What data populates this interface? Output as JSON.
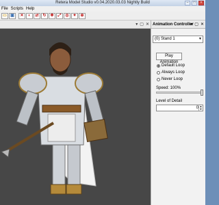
{
  "window": {
    "title": "Retera Model Studio v0.04.2020.03.03 Nightly Build"
  },
  "menu": {
    "items": [
      "File",
      "Scripts",
      "Help"
    ]
  },
  "toolbar": {
    "icons": [
      "folder-icon",
      "save-icon",
      "tool-icon-1",
      "tool-icon-2",
      "tool-icon-3",
      "tool-icon-4",
      "tool-icon-5",
      "tool-icon-6",
      "tool-icon-7",
      "tool-icon-8",
      "tool-icon-9"
    ]
  },
  "panel": {
    "title": "Animation Controller",
    "animation_selected": "(0) Stand 1",
    "play_label": "Play Animation",
    "loop_options": [
      "Default Loop",
      "Always Loop",
      "Never Loop"
    ],
    "loop_selected": "Default Loop",
    "speed_label": "Speed: 100%",
    "speed_fraction": 1.0,
    "lod_label": "Level of Detail",
    "lod_value": "0"
  },
  "colors": {
    "viewport_bg": "#474747",
    "accent": "#6d8fb8"
  }
}
